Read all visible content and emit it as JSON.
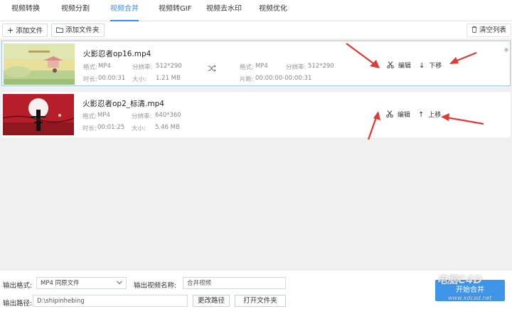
{
  "tabs": [
    "视频转换",
    "视频分割",
    "视频合并",
    "视频转GIF",
    "视频去水印",
    "视频优化"
  ],
  "active_tab": "视频合并",
  "toolbar": {
    "add_file": "添加文件",
    "add_folder": "添加文件夹",
    "clear_list": "清空列表"
  },
  "files": [
    {
      "name": "火影忍者op16.mp4",
      "format_label": "格式:",
      "format": "MP4",
      "resolution_label": "分辨率:",
      "resolution": "512*290",
      "duration_label": "时长:",
      "duration": "00:00:31",
      "size_label": "大小:",
      "size": "1.21 MB",
      "out_format_label": "格式:",
      "out_format": "MP4",
      "out_resolution_label": "分辨率:",
      "out_resolution": "512*290",
      "segment_label": "片断:",
      "segment": "00:00:00-00:00:31",
      "edit_label": "编辑",
      "move_label": "下移",
      "selected": true
    },
    {
      "name": "火影忍者op2_标清.mp4",
      "format_label": "格式:",
      "format": "MP4",
      "resolution_label": "分辨率:",
      "resolution": "640*360",
      "duration_label": "时长:",
      "duration": "00:01:25",
      "size_label": "大小:",
      "size": "5.46 MB",
      "edit_label": "编辑",
      "move_label": "上移",
      "selected": false
    }
  ],
  "bottom": {
    "output_format_label": "输出格式:",
    "output_format_value": "MP4 同原文件",
    "output_name_label": "输出视频名称:",
    "output_name_value": "合并视频",
    "output_path_label": "输出路径:",
    "output_path_value": "D:\\shipinhebing",
    "change_path": "更改路径",
    "open_folder": "打开文件夹",
    "start_merge": "开始合并"
  },
  "watermark": {
    "line1": "电脑C4D",
    "line2": "www.xdcad.net"
  },
  "colors": {
    "accent": "#3a8ee6",
    "merge_button": "#3f95e8",
    "list_background": "#f0f0f0",
    "selected_border": "#9fc9f0",
    "arrow_red": "#e03a35"
  }
}
